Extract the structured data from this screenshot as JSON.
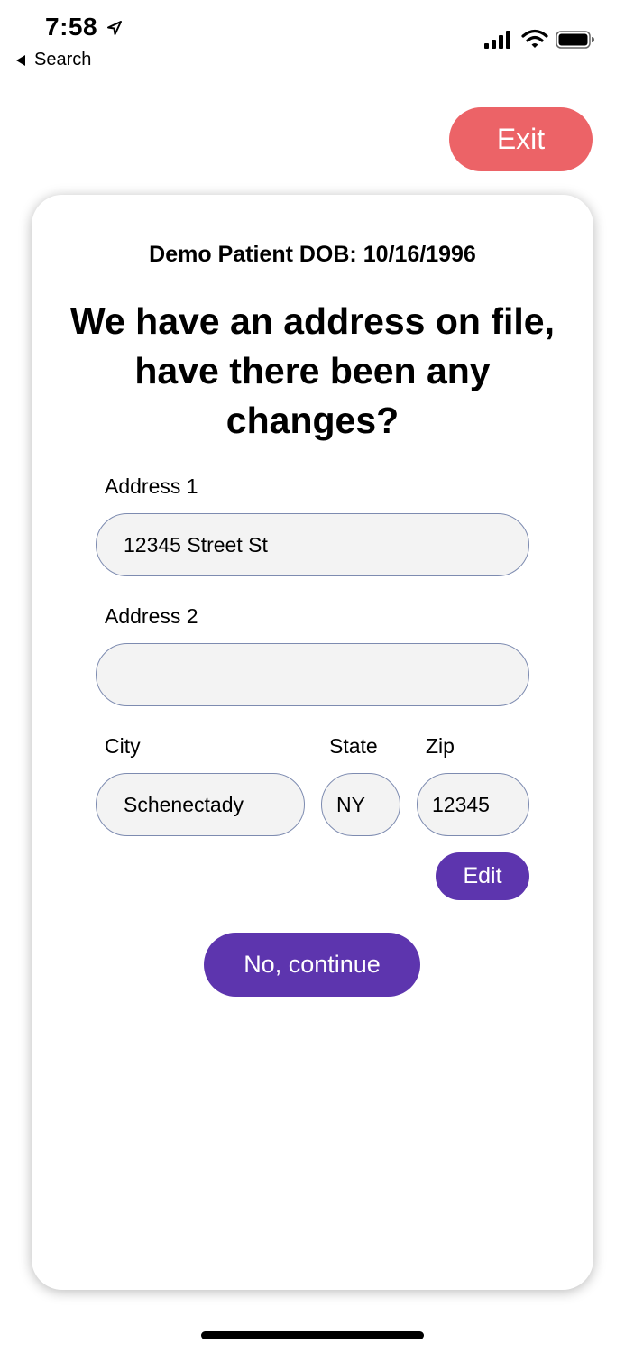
{
  "status_bar": {
    "time": "7:58",
    "back_label": "Search",
    "icons": [
      "location-arrow-icon",
      "cellular-signal-icon",
      "wifi-icon",
      "battery-icon"
    ]
  },
  "header": {
    "exit_label": "Exit",
    "exit_color": "#ec6367"
  },
  "card": {
    "patient_line": "Demo Patient DOB: 10/16/1996",
    "question": "We have an address on file, have there been any changes?",
    "fields": {
      "address1": {
        "label": "Address 1",
        "value": "12345 Street St"
      },
      "address2": {
        "label": "Address 2",
        "value": ""
      },
      "city": {
        "label": "City",
        "value": "Schenectady"
      },
      "state": {
        "label": "State",
        "value": "NY"
      },
      "zip": {
        "label": "Zip",
        "value": "12345"
      }
    },
    "edit_label": "Edit",
    "continue_label": "No, continue",
    "accent_color": "#5d35ae"
  }
}
